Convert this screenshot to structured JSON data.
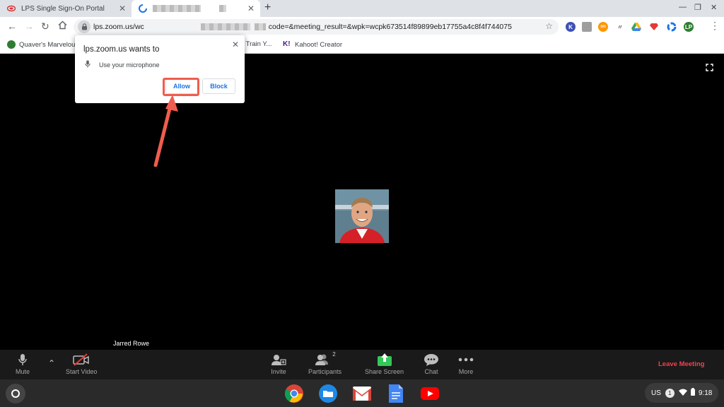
{
  "browser": {
    "tabs": [
      {
        "title": "LPS Single Sign-On Portal"
      },
      {
        "title": ""
      }
    ],
    "url_visible_start": "lps.zoom.us/wc",
    "url_visible_end": "code=&meeting_result=&wpk=wcpk673514f89899eb17755a4c8f4f744075",
    "bookmarks": [
      {
        "label": "Quaver's Marvelous"
      },
      {
        "label": "- Train Y..."
      },
      {
        "label": "Kahoot! Creator"
      }
    ],
    "extensions": [
      {
        "letter": "K",
        "color": "#3f51b5"
      },
      {
        "letter": "on",
        "color": "#ff9800"
      }
    ]
  },
  "permission_prompt": {
    "title": "lps.zoom.us wants to",
    "permission": "Use your microphone",
    "allow_label": "Allow",
    "block_label": "Block"
  },
  "meeting": {
    "participant_name": "Jarred Rowe",
    "participants_count": "2",
    "controls": {
      "mute": "Mute",
      "start_video": "Start Video",
      "invite": "Invite",
      "participants": "Participants",
      "share_screen": "Share Screen",
      "chat": "Chat",
      "more": "More",
      "leave": "Leave Meeting"
    },
    "leave_color": "#f0424f",
    "share_color": "#34c759"
  },
  "system_tray": {
    "keyboard_layout": "US",
    "notification_count": "1",
    "time": "9:18"
  }
}
